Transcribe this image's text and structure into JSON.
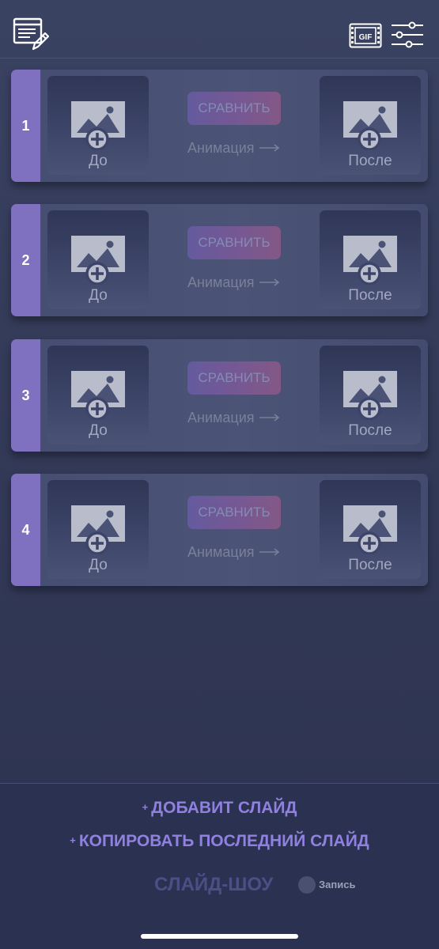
{
  "header": {
    "notes_icon": "notes-edit-icon",
    "gif_icon": "gif-film-icon",
    "gif_text": "GIF",
    "settings_icon": "sliders-icon"
  },
  "slides": [
    {
      "number": "1",
      "before_label": "До",
      "after_label": "После",
      "compare_label": "СРАВНИТЬ",
      "animation_label": "Анимация"
    },
    {
      "number": "2",
      "before_label": "До",
      "after_label": "После",
      "compare_label": "СРАВНИТЬ",
      "animation_label": "Анимация"
    },
    {
      "number": "3",
      "before_label": "До",
      "after_label": "После",
      "compare_label": "СРАВНИТЬ",
      "animation_label": "Анимация"
    },
    {
      "number": "4",
      "before_label": "До",
      "after_label": "После",
      "compare_label": "СРАВНИТЬ",
      "animation_label": "Анимация"
    }
  ],
  "actions": {
    "add_plus": "+",
    "add_slide": "ДОБАВИТ СЛАЙД",
    "copy_plus": "+",
    "copy_last": "КОПИРОВАТЬ ПОСЛЕДНИЙ СЛАЙД",
    "slideshow": "СЛАЙД-ШОУ",
    "record": "Запись"
  },
  "colors": {
    "accent": "#8070c0",
    "action_text": "#9080e0",
    "background": "#333a58"
  }
}
